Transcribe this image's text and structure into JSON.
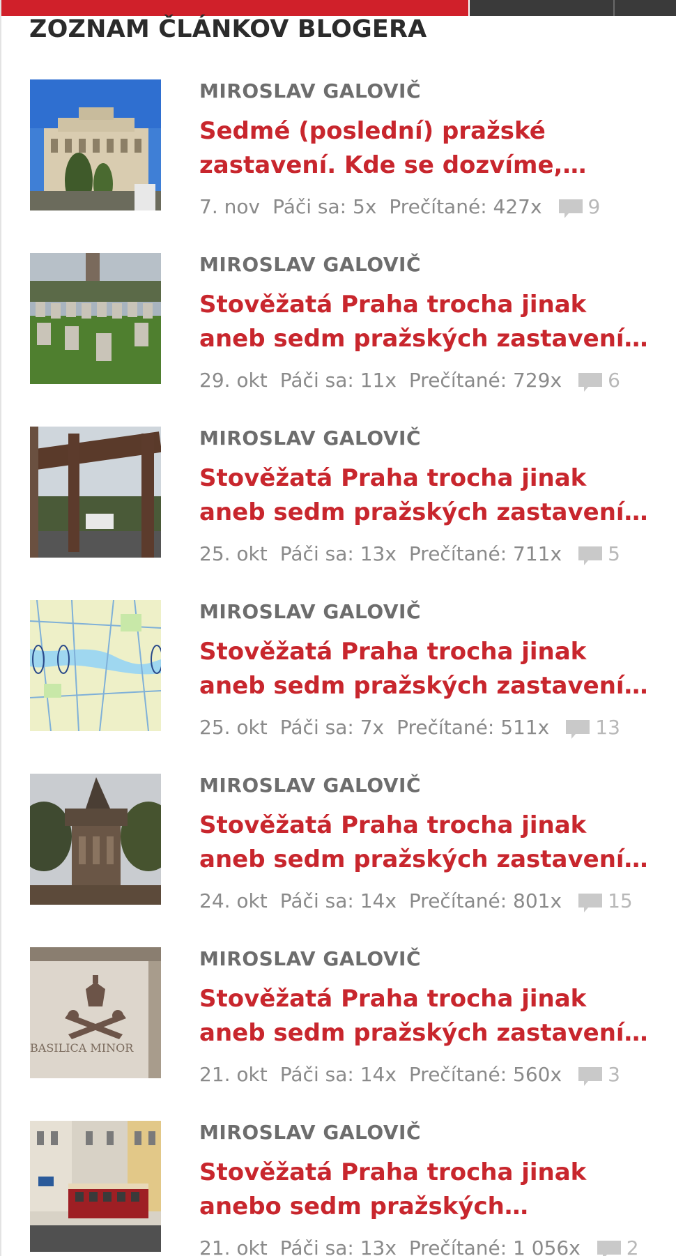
{
  "header": {
    "title": "ZOZNAM ČLÁNKOV BLOGERA"
  },
  "colors": {
    "accent": "#c8262d",
    "topbar_red": "#d0202a",
    "topbar_dark": "#3a3a3a",
    "meta_gray": "#8a8a8a"
  },
  "articles": [
    {
      "author": "MIROSLAV GALOVIČ",
      "title": "Sedmé (poslední) pražské zastavení. Kde se dozvíme, proč…",
      "date": "7. nov",
      "likes": "Páči sa: 5x",
      "reads": "Prečítané: 427x",
      "comments": "9",
      "thumb_icon": "photo-concert-hall"
    },
    {
      "author": "MIROSLAV GALOVIČ",
      "title": "Stověžatá Praha trocha jinak aneb sedm pražských zastavení. Dnes…",
      "date": "29. okt",
      "likes": "Páči sa: 11x",
      "reads": "Prečítané: 729x",
      "comments": "6",
      "thumb_icon": "photo-cemetery"
    },
    {
      "author": "MIROSLAV GALOVIČ",
      "title": "Stověžatá Praha trocha jinak aneb sedm pražských zastavení. Dnes…",
      "date": "25. okt",
      "likes": "Páči sa: 13x",
      "reads": "Prečítané: 711x",
      "comments": "5",
      "thumb_icon": "photo-cemetery-gate"
    },
    {
      "author": "MIROSLAV GALOVIČ",
      "title": "Stověžatá Praha trocha jinak aneb sedm pražských zastavení. Dnes…",
      "date": "25. okt",
      "likes": "Páči sa: 7x",
      "reads": "Prečítané: 511x",
      "comments": "13",
      "thumb_icon": "photo-map"
    },
    {
      "author": "MIROSLAV GALOVIČ",
      "title": "Stověžatá Praha trocha jinak aneb sedm pražských zastavení. Dnes…",
      "date": "24. okt",
      "likes": "Páči sa: 14x",
      "reads": "Prečítané: 801x",
      "comments": "15",
      "thumb_icon": "photo-monument"
    },
    {
      "author": "MIROSLAV GALOVIČ",
      "title": "Stověžatá Praha trocha jinak aneb sedm pražských zastavení. Dnes…",
      "date": "21. okt",
      "likes": "Páči sa: 14x",
      "reads": "Prečítané: 560x",
      "comments": "3",
      "thumb_icon": "photo-basilica-emblem",
      "thumb_caption": "BASILICA MINOR"
    },
    {
      "author": "MIROSLAV GALOVIČ",
      "title": "Stověžatá Praha trocha jinak anebo sedm pražských zastaven…",
      "date": "21. okt",
      "likes": "Páči sa: 13x",
      "reads": "Prečítané: 1 056x",
      "comments": "2",
      "thumb_icon": "photo-tram"
    }
  ]
}
